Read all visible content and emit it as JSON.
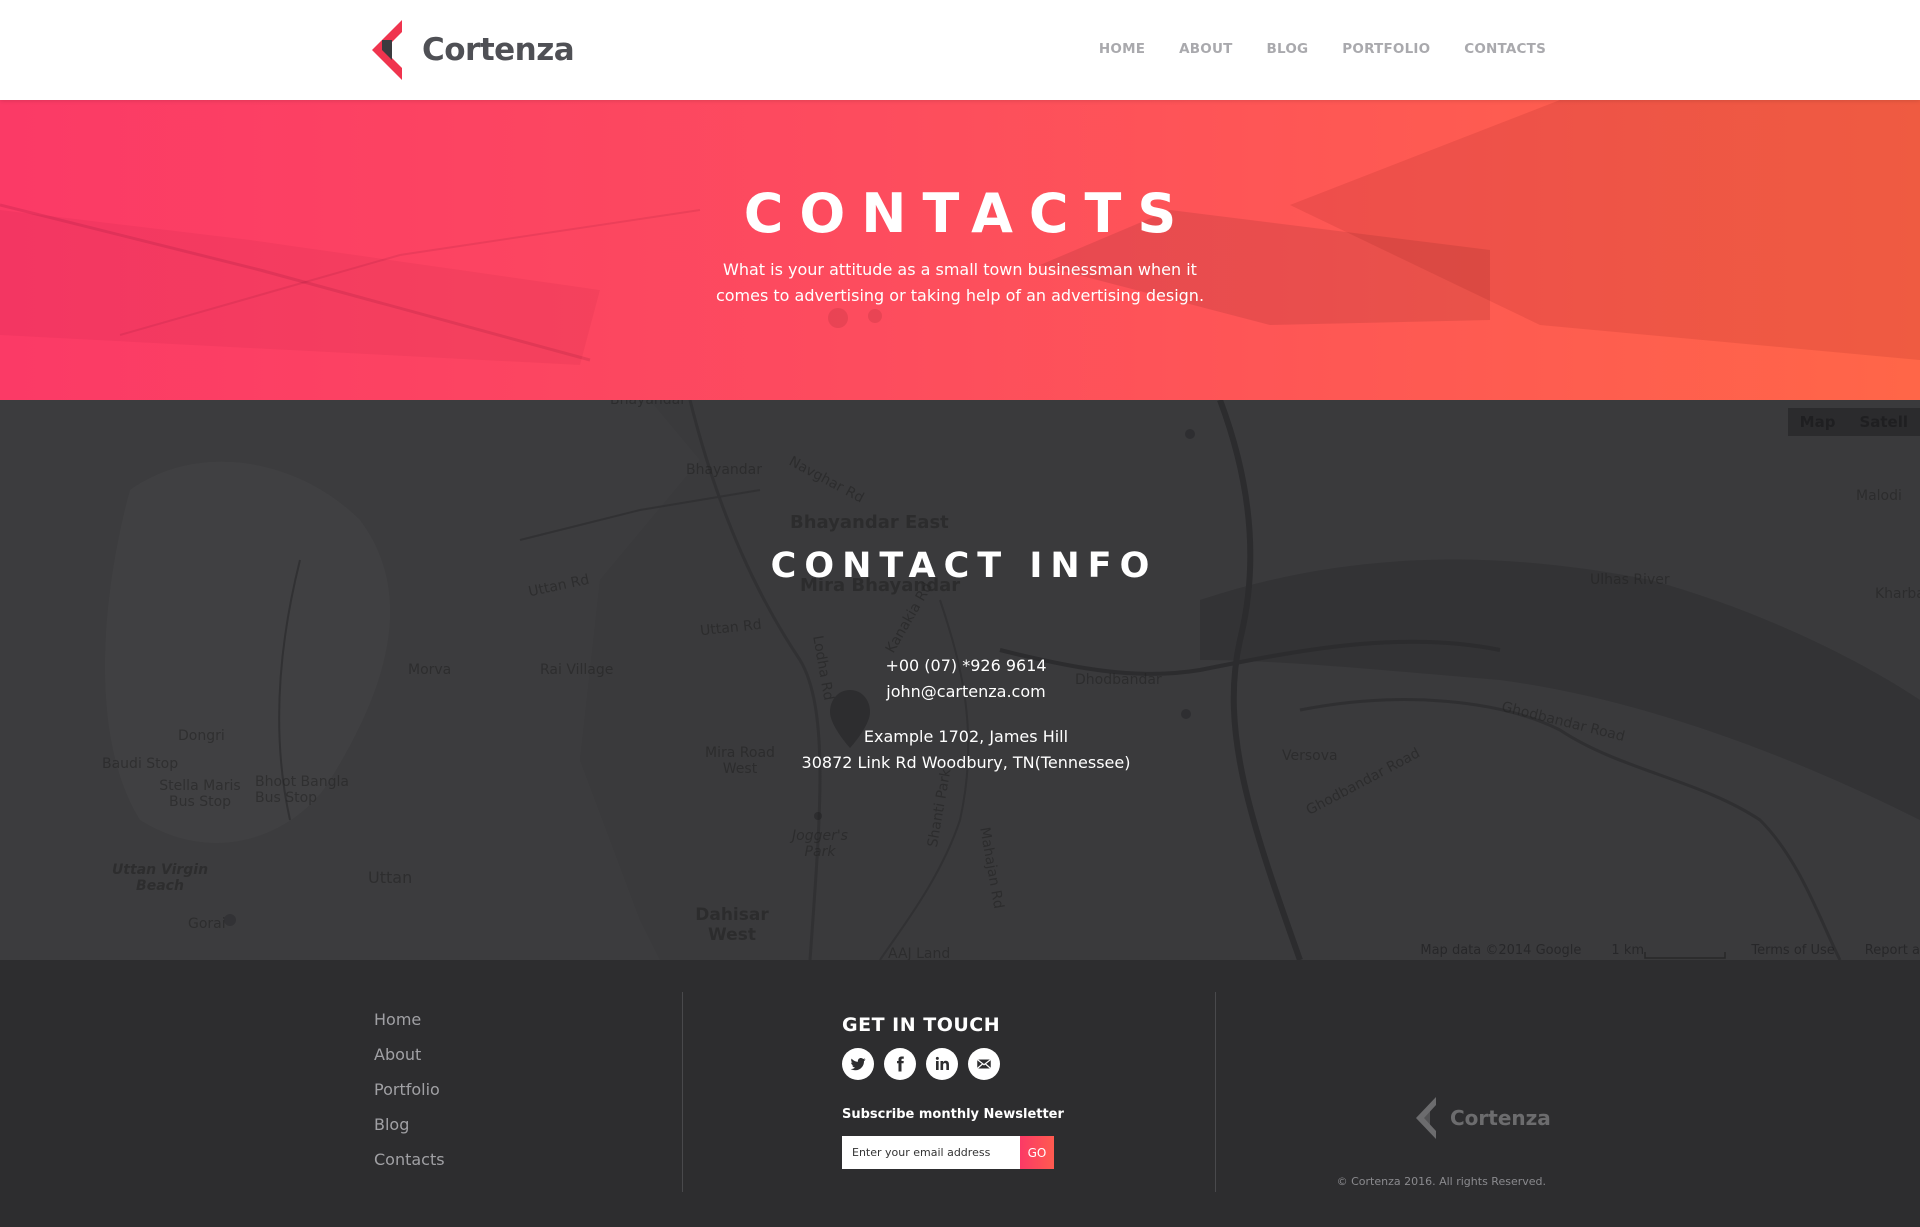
{
  "header": {
    "brand": "Cortenza",
    "nav": [
      "HOME",
      "ABOUT",
      "BLOG",
      "PORTFOLIO",
      "CONTACTS"
    ]
  },
  "hero": {
    "title": "CONTACTS",
    "subtitle_line1": "What is your attitude as a small town businessman when it",
    "subtitle_line2": "comes to advertising or taking help of an advertising design."
  },
  "map": {
    "type_buttons": [
      "Map",
      "Satell"
    ],
    "labels": [
      "Bhayandar",
      "Navghar Rd",
      "Bhayandar East",
      "Mira Bhayandar",
      "Uttan Rd",
      "Uttan Rd",
      "Morva",
      "Rai Village",
      "Dongri",
      "Baudi Stop",
      "Stella Maris Bus Stop",
      "Bhoot Bangla Bus Stop",
      "Uttan Virgin Beach",
      "Uttan",
      "Gorai",
      "Mira Road West",
      "Jogger's Park",
      "Dahisar West",
      "Dhodbandar",
      "Versova",
      "Ulhas River",
      "Malodi",
      "Kharba",
      "Ghodbandar Road",
      "Ghodbandar Road",
      "Lodha Rd",
      "Shanti Park",
      "Mahajan Rd",
      "Kanakia Rd",
      "AAJ Land"
    ],
    "footer": [
      "Map data ©2014 Google",
      "1 km",
      "Terms of Use",
      "Report a"
    ],
    "contact_title": "CONTACT INFO",
    "phone": "+00 (07) *926 9614",
    "email": "john@cartenza.com",
    "address1": "Example 1702, James Hill",
    "address2": "30872 Link Rd Woodbury,  TN(Tennessee)"
  },
  "footer": {
    "links": [
      "Home",
      "About",
      "Portfolio",
      "Blog",
      "Contacts"
    ],
    "get_in_touch": "GET IN TOUCH",
    "social_icons": [
      "twitter-icon",
      "facebook-icon",
      "linkedin-icon",
      "mail-icon"
    ],
    "newsletter_label": "Subscribe monthly Newsletter",
    "newsletter_placeholder": "Enter your email address",
    "newsletter_button": "GO",
    "brand": "Cortenza",
    "copyright": "© Cortenza 2016. All rights Reserved."
  },
  "colors": {
    "accent_start": "#fb3a66",
    "accent_end": "#ff6648",
    "footer_bg": "#2d2d2f"
  }
}
